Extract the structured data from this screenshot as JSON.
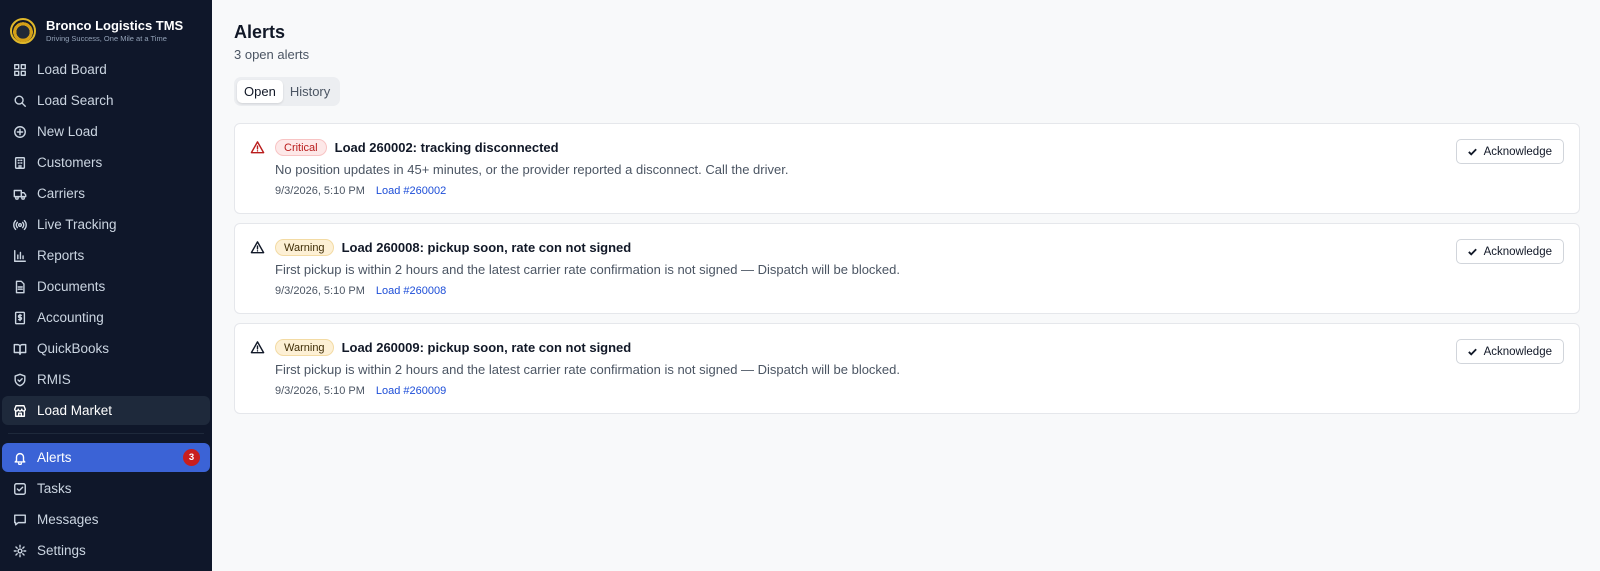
{
  "app": {
    "name": "Bronco Logistics TMS",
    "tagline": "Driving Success, One Mile at a Time"
  },
  "sidebar": {
    "primary": [
      {
        "label": "Load Board",
        "icon": "grid-icon"
      },
      {
        "label": "Load Search",
        "icon": "search-icon"
      },
      {
        "label": "New Load",
        "icon": "plus-circle-icon"
      },
      {
        "label": "Customers",
        "icon": "building-icon"
      },
      {
        "label": "Carriers",
        "icon": "truck-icon"
      },
      {
        "label": "Live Tracking",
        "icon": "radio-icon"
      },
      {
        "label": "Reports",
        "icon": "bar-chart-icon"
      },
      {
        "label": "Documents",
        "icon": "file-icon"
      },
      {
        "label": "Accounting",
        "icon": "receipt-icon"
      },
      {
        "label": "QuickBooks",
        "icon": "book-icon"
      },
      {
        "label": "RMIS",
        "icon": "shield-icon"
      },
      {
        "label": "Load Market",
        "icon": "store-icon"
      }
    ],
    "secondary": [
      {
        "label": "Alerts",
        "icon": "bell-icon",
        "badge": "3"
      },
      {
        "label": "Tasks",
        "icon": "check-square-icon"
      },
      {
        "label": "Messages",
        "icon": "message-icon"
      },
      {
        "label": "Settings",
        "icon": "gear-icon"
      }
    ],
    "hovered_item": "Load Market",
    "active_item": "Alerts"
  },
  "page": {
    "title": "Alerts",
    "subtitle": "3 open alerts",
    "tabs": [
      {
        "label": "Open",
        "active": true
      },
      {
        "label": "History",
        "active": false
      }
    ]
  },
  "alerts": [
    {
      "severity": "Critical",
      "severity_key": "critical",
      "title": "Load 260002: tracking disconnected",
      "description": "No position updates in 45+ minutes, or the provider reported a disconnect. Call the driver.",
      "time": "9/3/2026, 5:10 PM",
      "link": "Load #260002",
      "action": "Acknowledge"
    },
    {
      "severity": "Warning",
      "severity_key": "warning",
      "title": "Load 260008: pickup soon, rate con not signed",
      "description": "First pickup is within 2 hours and the latest carrier rate confirmation is not signed — Dispatch will be blocked.",
      "time": "9/3/2026, 5:10 PM",
      "link": "Load #260008",
      "action": "Acknowledge"
    },
    {
      "severity": "Warning",
      "severity_key": "warning",
      "title": "Load 260009: pickup soon, rate con not signed",
      "description": "First pickup is within 2 hours and the latest carrier rate confirmation is not signed — Dispatch will be blocked.",
      "time": "9/3/2026, 5:10 PM",
      "link": "Load #260009",
      "action": "Acknowledge"
    }
  ],
  "colors": {
    "sidebar_bg": "#0f172a",
    "active_nav": "#3b63d6",
    "critical": "#b91c1c",
    "link": "#1d4ed8"
  }
}
